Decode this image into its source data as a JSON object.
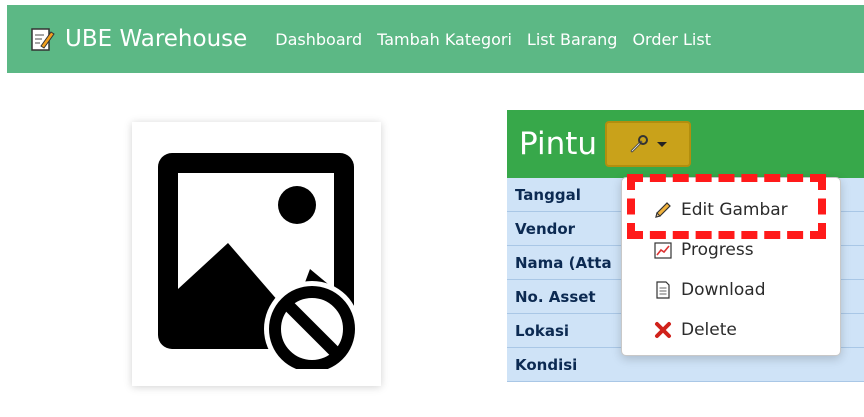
{
  "navbar": {
    "brand": "UBE Warehouse",
    "brand_icon": "memo-icon",
    "links": [
      "Dashboard",
      "Tambah Kategori",
      "List Barang",
      "Order List"
    ],
    "color": "#5cb885"
  },
  "image_card": {
    "icon": "no-image-icon"
  },
  "panel": {
    "title": "Pintu",
    "header_color": "#37a84a",
    "tool_button_icon": "wrench-icon",
    "rows": [
      "Tanggal",
      "Vendor",
      "Nama (Atta",
      "No. Asset",
      "Lokasi",
      "Kondisi"
    ]
  },
  "dropdown": {
    "items": [
      {
        "label": "Edit Gambar",
        "icon": "pencil-icon"
      },
      {
        "label": "Progress",
        "icon": "chart-icon"
      },
      {
        "label": "Download",
        "icon": "document-icon"
      },
      {
        "label": "Delete",
        "icon": "cross-icon"
      }
    ]
  },
  "highlight_color": "#ff1a1a"
}
